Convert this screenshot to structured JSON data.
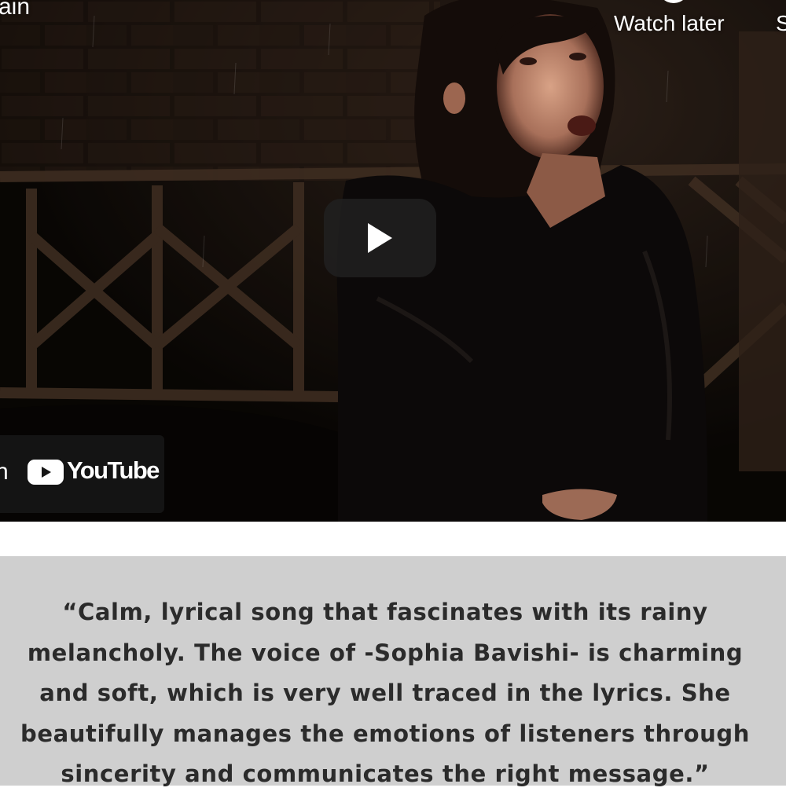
{
  "video": {
    "title": "ain",
    "watch_later_label": "Watch later",
    "share_label_peek": "S",
    "watch_on_prefix": "n",
    "platform": "YouTube",
    "icons": {
      "watch_later": "clock-icon",
      "play": "play-icon",
      "logo": "youtube-logo-icon"
    }
  },
  "quote": {
    "text": "“Calm, lyrical song that fascinates with its rainy melancholy. The voice of -Sophia Bavishi- is charming and soft, which is very well traced in the lyrics. She beautifully manages the emotions of listeners through sincerity and communicates the right message.”"
  },
  "colors": {
    "quote_background": "#cfcfcf",
    "quote_text": "#2b2b2b",
    "video_background": "#0d0906",
    "youtube_red": "#ff0000"
  }
}
